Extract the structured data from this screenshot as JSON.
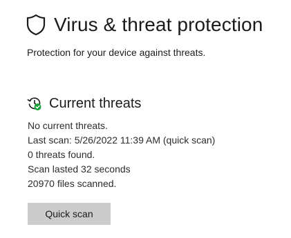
{
  "header": {
    "icon": "shield-icon",
    "title": "Virus & threat protection",
    "subtitle": "Protection for your device against threats."
  },
  "current_threats": {
    "icon": "scan-history-icon",
    "status_color": "#16a33a",
    "title": "Current threats",
    "status_lines": [
      "No current threats.",
      "Last scan: 5/26/2022 11:39 AM (quick scan)",
      "0 threats found.",
      "Scan lasted 32 seconds",
      "20970 files scanned."
    ],
    "quick_scan_label": "Quick scan"
  }
}
